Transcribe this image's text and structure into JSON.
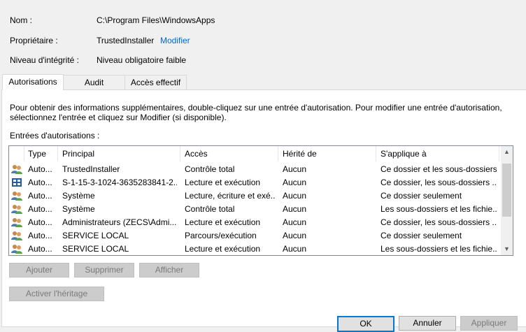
{
  "info": {
    "name_label": "Nom :",
    "name_value": "C:\\Program Files\\WindowsApps",
    "owner_label": "Propriétaire :",
    "owner_value": "TrustedInstaller",
    "owner_change_link": "Modifier",
    "integrity_label": "Niveau d'intégrité :",
    "integrity_value": "Niveau obligatoire faible"
  },
  "tabs": [
    {
      "label": "Autorisations",
      "active": true
    },
    {
      "label": "Audit",
      "active": false
    },
    {
      "label": "Accès effectif",
      "active": false
    }
  ],
  "panel": {
    "description_line1": "Pour obtenir des informations supplémentaires, double-cliquez sur une entrée d'autorisation. Pour modifier une entrée d'autorisation,",
    "description_line2": "sélectionnez l'entrée et cliquez sur Modifier (si disponible).",
    "entries_label": "Entrées d'autorisations :"
  },
  "table": {
    "columns": [
      "Type",
      "Principal",
      "Accès",
      "Hérité de",
      "S'applique à"
    ],
    "rows": [
      {
        "icon": "users-icon",
        "type": "Auto...",
        "principal": "TrustedInstaller",
        "access": "Contrôle total",
        "inherited": "Aucun",
        "applies": "Ce dossier et les sous-dossiers"
      },
      {
        "icon": "package-icon",
        "type": "Auto...",
        "principal": "S-1-15-3-1024-3635283841-2...",
        "access": "Lecture et exécution",
        "inherited": "Aucun",
        "applies": "Ce dossier, les sous-dossiers ..."
      },
      {
        "icon": "users-icon",
        "type": "Auto...",
        "principal": "Système",
        "access": "Lecture, écriture et exé...",
        "inherited": "Aucun",
        "applies": "Ce dossier seulement"
      },
      {
        "icon": "users-icon",
        "type": "Auto...",
        "principal": "Système",
        "access": "Contrôle total",
        "inherited": "Aucun",
        "applies": "Les sous-dossiers et les fichie..."
      },
      {
        "icon": "users-icon",
        "type": "Auto...",
        "principal": "Administrateurs (ZECS\\Admi...",
        "access": "Lecture et exécution",
        "inherited": "Aucun",
        "applies": "Ce dossier, les sous-dossiers ..."
      },
      {
        "icon": "users-icon",
        "type": "Auto...",
        "principal": "SERVICE LOCAL",
        "access": "Parcours/exécution",
        "inherited": "Aucun",
        "applies": "Ce dossier seulement"
      },
      {
        "icon": "users-icon",
        "type": "Auto...",
        "principal": "SERVICE LOCAL",
        "access": "Lecture et exécution",
        "inherited": "Aucun",
        "applies": "Les sous-dossiers et les fichie..."
      }
    ]
  },
  "buttons": {
    "add": "Ajouter",
    "remove": "Supprimer",
    "view": "Afficher",
    "enable_inheritance": "Activer l'héritage",
    "ok": "OK",
    "cancel": "Annuler",
    "apply": "Appliquer"
  },
  "colors": {
    "accent": "#0078d7",
    "link": "#0066cc",
    "panel_bg": "#ffffff",
    "window_bg": "#f0f0f0",
    "disabled_button": "#cccccc"
  }
}
